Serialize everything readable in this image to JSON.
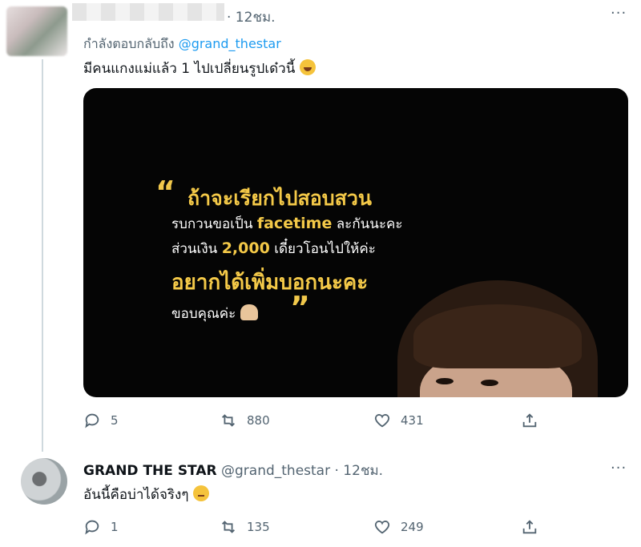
{
  "tweet1": {
    "time": "· 12ชม.",
    "replying_prefix": "กำลังตอบกลับถึง",
    "replying_mention": "@grand_thestar",
    "text": "มีคนแกงแม่แล้ว 1 ไปเปลี่ยนรูปเด๋วนี้",
    "emoji": "rolling-on-floor-laughing-icon",
    "media": {
      "line1": "ถ้าจะเรียกไปสอบสวน",
      "line2_a": "รบกวนขอเป็น",
      "line2_b": "facetime",
      "line2_c": "ละกันนะคะ",
      "line3_a": "ส่วนเงิน",
      "line3_b": "2,000",
      "line3_c": "เดี๋ยวโอนไปให้ค่ะ",
      "line4": "อยากได้เพิ่มบอกนะคะ",
      "line5": "ขอบคุณค่ะ",
      "open_quote": "“",
      "close_quote": "”"
    },
    "replies": "5",
    "retweets": "880",
    "likes": "431"
  },
  "tweet2": {
    "display_name": "GRAND THE STAR",
    "handle": "@grand_thestar",
    "time": "· 12ชม.",
    "text": "อันนี้คือบ่าได้จริงๆ",
    "emoji": "pensive-face-icon",
    "replies": "1",
    "retweets": "135",
    "likes": "249"
  },
  "more_label": "···",
  "colors": {
    "accent": "#1d9bf0",
    "muted": "#536471",
    "highlight": "#f4c948"
  }
}
